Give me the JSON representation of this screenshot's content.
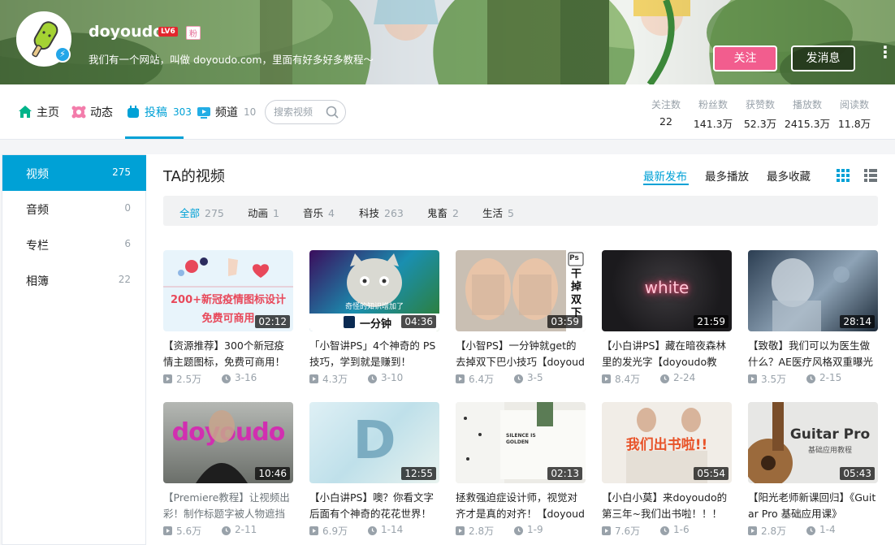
{
  "user": {
    "name": "doyoudo",
    "level": "LV6",
    "fan_badge": "粉",
    "sign": "我们有一个网站，叫做 doyoudo.com，里面有好多好多教程～",
    "follow_label": "关注",
    "message_label": "发消息"
  },
  "nav": {
    "home": "主页",
    "dynamic": "动态",
    "contribute": "投稿",
    "contribute_count": "303",
    "channel": "频道",
    "channel_count": "10",
    "search_placeholder": "搜索视频"
  },
  "stats": [
    {
      "label": "关注数",
      "value": "22"
    },
    {
      "label": "粉丝数",
      "value": "141.3万"
    },
    {
      "label": "获赞数",
      "value": "52.3万"
    },
    {
      "label": "播放数",
      "value": "2415.3万"
    },
    {
      "label": "阅读数",
      "value": "11.8万"
    }
  ],
  "sidebar": [
    {
      "label": "视频",
      "count": "275"
    },
    {
      "label": "音频",
      "count": "0"
    },
    {
      "label": "专栏",
      "count": "6"
    },
    {
      "label": "相簿",
      "count": "22"
    }
  ],
  "content": {
    "title": "TA的视频",
    "sort": [
      "最新发布",
      "最多播放",
      "最多收藏"
    ],
    "filters": [
      {
        "label": "全部",
        "count": "275"
      },
      {
        "label": "动画",
        "count": "1"
      },
      {
        "label": "音乐",
        "count": "4"
      },
      {
        "label": "科技",
        "count": "263"
      },
      {
        "label": "鬼畜",
        "count": "2"
      },
      {
        "label": "生活",
        "count": "5"
      }
    ]
  },
  "colors": {
    "accent": "#00a1d6",
    "follow": "#f25d8e"
  },
  "videos": [
    {
      "title": "【资源推荐】300个新冠疫情主题图标，免费可商用！",
      "duration": "02:12",
      "plays": "2.5万",
      "date": "3-16",
      "thumb_text": "200+新冠疫情图标设计",
      "thumb_sub": "免费可商用"
    },
    {
      "title": "「小智讲PS」4个神奇的 PS 技巧，学到就是赚到！",
      "duration": "04:36",
      "plays": "4.3万",
      "date": "3-10",
      "thumb_text": "奇怪的知识增加了",
      "thumb_sub": "一分钟"
    },
    {
      "title": "【小智PS】一分钟就get的去掉双下巴小技巧【doyoudo教程】",
      "duration": "03:59",
      "plays": "6.4万",
      "date": "3-5",
      "thumb_text": "干掉双下",
      "thumb_sub": "Ps"
    },
    {
      "title": "【小白讲PS】藏在暗夜森林里的发光字【doyoudo教程】",
      "duration": "21:59",
      "plays": "8.4万",
      "date": "2-24",
      "thumb_text": "white",
      "thumb_sub": ""
    },
    {
      "title": "【致敬】我们可以为医生做什么？AE医疗风格双重曝光创意",
      "duration": "28:14",
      "plays": "3.5万",
      "date": "2-15",
      "thumb_text": "",
      "thumb_sub": ""
    },
    {
      "title": "【Premiere教程】让视频出彩！制作标题字被人物遮挡的效果",
      "duration": "10:46",
      "plays": "5.6万",
      "date": "2-11",
      "thumb_text": "doyoudo",
      "thumb_sub": ""
    },
    {
      "title": "【小白讲PS】噢？你看文字后面有个神奇的花花世界！",
      "duration": "12:55",
      "plays": "6.9万",
      "date": "1-14",
      "thumb_text": "D",
      "thumb_sub": ""
    },
    {
      "title": "拯救强迫症设计师，视觉对齐才是真的对齐！【doyoudo教程】",
      "duration": "02:13",
      "plays": "2.8万",
      "date": "1-9",
      "thumb_text": "SILENCE IS GOLDEN",
      "thumb_sub": ""
    },
    {
      "title": "【小白小莫】来doyoudo的第三年~我们出书啦！！！",
      "duration": "05:54",
      "plays": "7.6万",
      "date": "1-6",
      "thumb_text": "我们出书啦!!",
      "thumb_sub": ""
    },
    {
      "title": "【阳光老师新课回归】《Guitar Pro 基础应用课》",
      "duration": "05:43",
      "plays": "2.8万",
      "date": "1-4",
      "thumb_text": "Guitar Pro",
      "thumb_sub": "基础应用教程"
    }
  ]
}
